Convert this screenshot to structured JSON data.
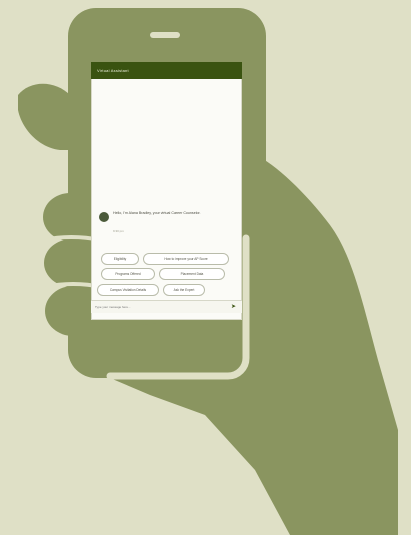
{
  "colors": {
    "background": "#dfe0c6",
    "phone_and_hand": "#8a9560",
    "app_header": "#3a5310",
    "screen": "#fbfbf7"
  },
  "app": {
    "header_title": "Virtual Assistant",
    "bot_message": "Hello, I'm Alana Bradley, your virtual Career Counselor.",
    "bot_time": "9:30 pm",
    "chips": [
      "Eligibility",
      "How to improve your AP Score",
      "Programs Offered",
      "Placement Data",
      "Campus Visitation Details",
      "Ask the Expert"
    ],
    "input_placeholder": "Type your message here..."
  },
  "icons": {
    "send": "send-icon",
    "home_button": "home-button-icon",
    "speaker": "speaker-icon"
  }
}
